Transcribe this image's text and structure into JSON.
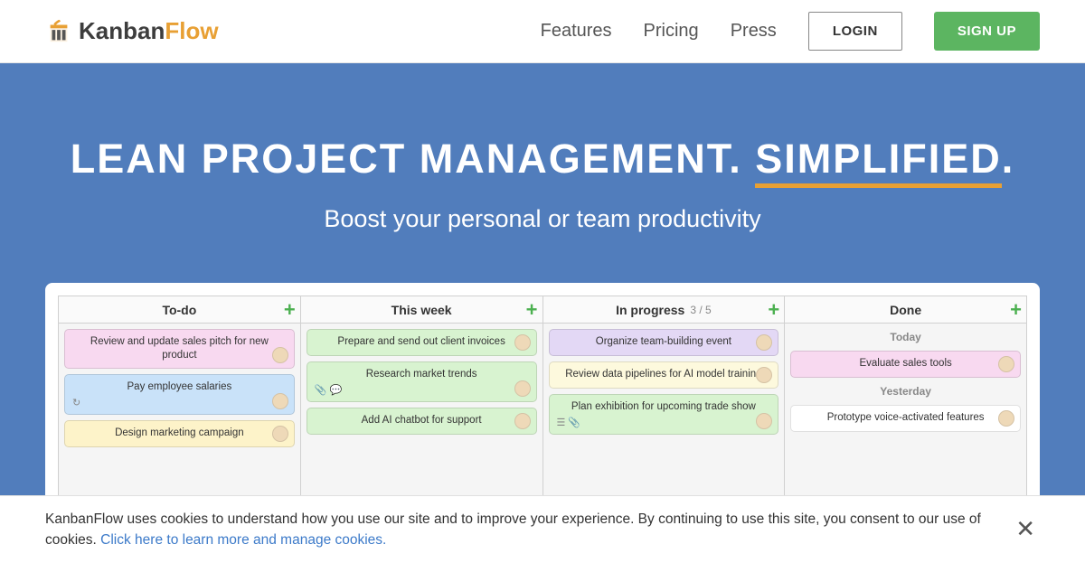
{
  "header": {
    "logo_prefix": "Kanban",
    "logo_suffix": "Flow",
    "nav": [
      "Features",
      "Pricing",
      "Press"
    ],
    "login": "LOGIN",
    "signup": "SIGN UP"
  },
  "hero": {
    "title_pre": "LEAN PROJECT MANAGEMENT. ",
    "title_em": "SIMPLIFIED",
    "title_post": ".",
    "subtitle": "Boost your personal or team productivity"
  },
  "board": {
    "columns": [
      {
        "name": "To-do",
        "cards": [
          {
            "title": "Review and update sales pitch for new product",
            "color": "pink",
            "avatar": true
          },
          {
            "title": "Pay employee salaries",
            "color": "blue",
            "avatar": true,
            "meta": "↻"
          },
          {
            "title": "Design marketing campaign",
            "color": "yellow",
            "avatar": true
          }
        ]
      },
      {
        "name": "This week",
        "cards": [
          {
            "title": "Prepare and send out client invoices",
            "color": "green",
            "avatar": true
          },
          {
            "title": "Research market trends",
            "color": "green",
            "avatar": true,
            "meta": "📎 💬"
          },
          {
            "title": "Add AI chatbot for support",
            "color": "green",
            "avatar": true
          }
        ]
      },
      {
        "name": "In progress",
        "wip": "3 / 5",
        "cards": [
          {
            "title": "Organize team-building event",
            "color": "purple",
            "avatar": true
          },
          {
            "title": "Review data pipelines for AI model training",
            "color": "lyellow",
            "avatar": true
          },
          {
            "title": "Plan exhibition for upcoming trade show",
            "color": "green",
            "avatar": true,
            "meta": "☰ 📎"
          }
        ]
      },
      {
        "name": "Done",
        "groups": [
          {
            "label": "Today",
            "cards": [
              {
                "title": "Evaluate sales tools",
                "color": "pink",
                "avatar": true
              }
            ]
          },
          {
            "label": "Yesterday",
            "cards": [
              {
                "title": "Prototype voice-activated features",
                "color": "white",
                "avatar": true
              }
            ]
          }
        ]
      }
    ]
  },
  "cookie": {
    "text": "KanbanFlow uses cookies to understand how you use our site and to improve your experience. By continuing to use this site, you consent to our use of cookies. ",
    "link": "Click here to learn more and manage cookies."
  }
}
